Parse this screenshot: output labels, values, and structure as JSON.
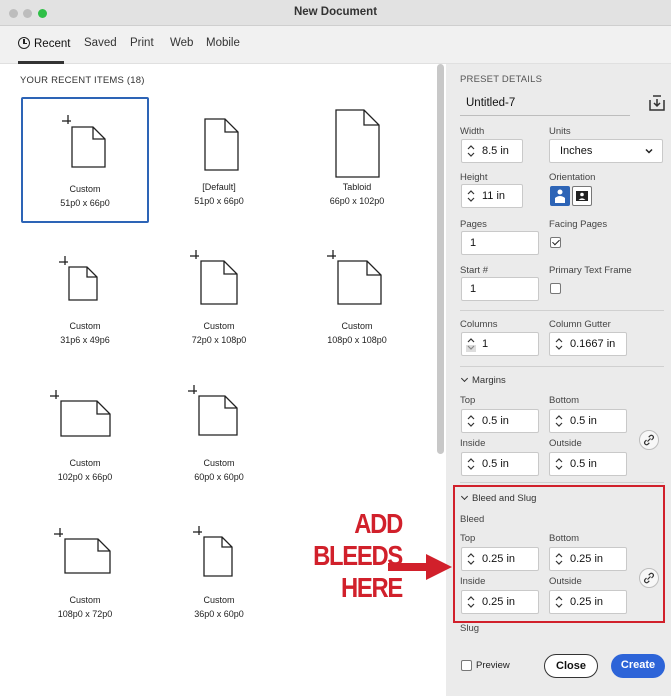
{
  "window": {
    "title": "New Document"
  },
  "tabs": [
    {
      "label": "Recent",
      "icon": "clock-icon",
      "active": true
    },
    {
      "label": "Saved"
    },
    {
      "label": "Print"
    },
    {
      "label": "Web"
    },
    {
      "label": "Mobile"
    }
  ],
  "recent": {
    "heading": "YOUR RECENT ITEMS",
    "count": "(18)",
    "items": [
      {
        "name": "Custom",
        "size": "51p0 x 66p0",
        "icon": "page-with-bleed-icon"
      },
      {
        "name": "[Default]",
        "size": "51p0 x 66p0",
        "icon": "page-icon"
      },
      {
        "name": "Tabloid",
        "size": "66p0 x 102p0",
        "icon": "page-icon"
      },
      {
        "name": "Custom",
        "size": "31p6 x 49p6",
        "icon": "page-with-bleed-icon"
      },
      {
        "name": "Custom",
        "size": "72p0 x 108p0",
        "icon": "page-with-bleed-icon"
      },
      {
        "name": "Custom",
        "size": "108p0 x 108p0",
        "icon": "page-with-bleed-icon"
      },
      {
        "name": "Custom",
        "size": "102p0 x 66p0",
        "icon": "landscape-page-with-bleed-icon"
      },
      {
        "name": "Custom",
        "size": "60p0 x 60p0",
        "icon": "square-page-with-bleed-icon"
      },
      {
        "name": "Custom",
        "size": "108p0 x 72p0",
        "icon": "landscape-page-with-bleed-icon"
      },
      {
        "name": "Custom",
        "size": "36p0 x 60p0",
        "icon": "page-with-bleed-icon"
      }
    ]
  },
  "preset": {
    "heading": "PRESET DETAILS",
    "name": "Untitled-7",
    "save_icon": "save-preset-icon",
    "width_label": "Width",
    "width": "8.5 in",
    "units_label": "Units",
    "units": "Inches",
    "height_label": "Height",
    "height": "11 in",
    "orientation_label": "Orientation",
    "pages_label": "Pages",
    "pages": "1",
    "facing_label": "Facing Pages",
    "facing_checked": true,
    "start_label": "Start #",
    "start": "1",
    "primary_label": "Primary Text Frame",
    "primary_checked": false,
    "columns_label": "Columns",
    "columns": "1",
    "gutter_label": "Column Gutter",
    "gutter": "0.1667 in"
  },
  "margins": {
    "heading": "Margins",
    "top_label": "Top",
    "top": "0.5 in",
    "bottom_label": "Bottom",
    "bottom": "0.5 in",
    "inside_label": "Inside",
    "inside": "0.5 in",
    "outside_label": "Outside",
    "outside": "0.5 in"
  },
  "bleed": {
    "heading": "Bleed and Slug",
    "bleed_label": "Bleed",
    "top_label": "Top",
    "top": "0.25 in",
    "bottom_label": "Bottom",
    "bottom": "0.25 in",
    "inside_label": "Inside",
    "inside": "0.25 in",
    "outside_label": "Outside",
    "outside": "0.25 in",
    "slug_label": "Slug"
  },
  "footer": {
    "preview_label": "Preview",
    "close_label": "Close",
    "create_label": "Create"
  },
  "annotation": {
    "line1": "ADD",
    "line2": "BLEEDS",
    "line3": "HERE"
  },
  "colors": {
    "accent": "#2d64b6",
    "create": "#2d64d8",
    "annotation": "#d1202b"
  }
}
